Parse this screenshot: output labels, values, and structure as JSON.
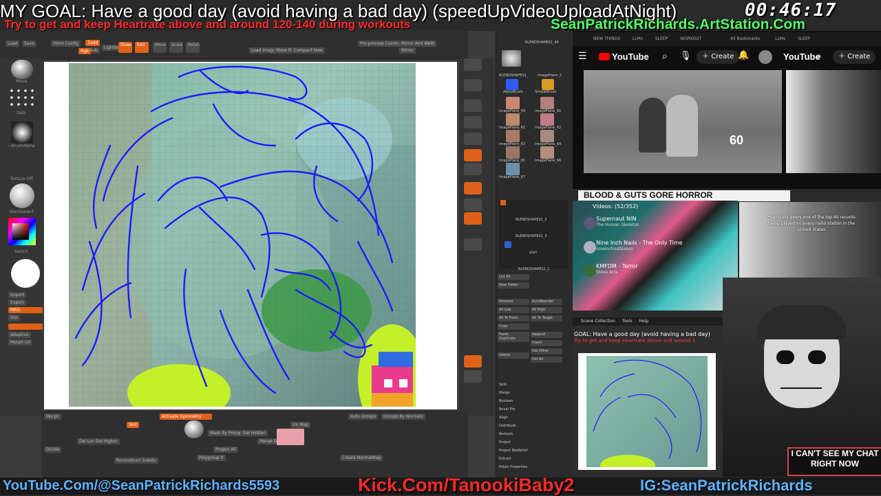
{
  "overlay": {
    "goal": "MY GOAL:   Have a good day (avoid having a bad day) (speedUpVideoUploadAtNight)",
    "clock": "00:46:17",
    "heartrate": "Try to get and keep Heartrate above and around 120-140 during workouts",
    "artstation": "SeanPatrickRichards.ArtStation.Com",
    "cant_see_chat": "I CAN'T SEE MY CHAT RIGHT NOW",
    "youtube": "YouTube.Com/@SeanPatrickRichards5593",
    "kick": "Kick.Com/TanookiBaby2",
    "instagram": "IG:SeanPatrickRichards"
  },
  "zbrush": {
    "top_buttons": [
      "Load",
      "Save",
      "Zadd",
      "Store Config",
      "Zsub",
      "Rgb",
      "Lightbox",
      "Draw",
      "Edit",
      "Move",
      "Scale",
      "Rotate",
      "Load Image",
      "Store Fill",
      "Compact Now",
      "Pre-process Current",
      "Mirror And Weld",
      "Mirror"
    ],
    "shelf_labels": [
      "Move",
      "Dots",
      "~BrushAlpha",
      "Texture Off",
      "SkinShade4",
      "Switch",
      "Import",
      "Export",
      "MRG",
      "Grp",
      "Adaptive",
      "Morph UV"
    ],
    "bottom_buttons": [
      "Morph",
      "Smt",
      "Activate Symmetry",
      "Auto Groups",
      "Groups By Normals",
      "Del Lower",
      "Del Higher",
      "Mask By Polygroups",
      "Merge Down",
      "Project All",
      "Divide",
      "Reconstruct Subdiv",
      "Create NormalMap",
      "Del Hidden",
      "UV Map",
      "Polygroup It"
    ],
    "subtool_items": [
      "BLENDSHAPES1_2",
      "BLENDSHAPES1_3",
      "shirt",
      "BLENDSHAPES1_1"
    ],
    "subtool_buttons": [
      "List All",
      "New Folder",
      "Rename",
      "AutoReorder",
      "All Low",
      "All High",
      "All To Front",
      "All To Target",
      "Copy",
      "Paste",
      "Duplicate",
      "Append",
      "Insert",
      "Delete",
      "Del Other",
      "Del All",
      "Split",
      "Merge",
      "Boolean",
      "Bevel Pro",
      "Align",
      "Distribute",
      "Remesh",
      "Project",
      "Project BasRelief",
      "Extract",
      "Polish Properties"
    ],
    "tray_labels": [
      "BLENDSHAPES1_49",
      "BLENDSHAPES1_",
      "ImagePlane_2",
      "AlphaBrush",
      "SimpleBrush",
      "ImagePlane_59",
      "ImagePlane_60",
      "ImagePlane_61",
      "ImagePlane_62",
      "ImagePlane_63",
      "ImagePlane_64",
      "ImagePlane_65",
      "ImagePlane_66",
      "ImagePlane_67"
    ]
  },
  "browser": {
    "bookmarks": [
      "NEW THINGS",
      "LLMs",
      "SLEEP",
      "WORKOUT",
      "All Bookmarks",
      "LLMs",
      "SLEEP"
    ],
    "yt_logo": "YouTube",
    "create": "Create",
    "video_counter": "60",
    "playlist_title": "BLOOD & GUTS GORE HORROR",
    "playlist_count": "Videos: (52/352)",
    "playlist_items": [
      {
        "title": "Supernaut NIN",
        "sub": "The Human Skeleton"
      },
      {
        "title": "Nine Inch Nails - The Only Time",
        "sub": "nineinchnailsvevo"
      },
      {
        "title": "KMFDM - Terror",
        "sub": "Steve Arra"
      }
    ],
    "caption": "Practically every one of the top 40 records being played on every radio station in the United States"
  },
  "mini": {
    "menu": [
      "Scene Collection",
      "Tools",
      "Help"
    ],
    "goal": "GOAL:  Have a good day (avoid having a bad day)",
    "hr": "Try to get and keep Heartrate above and around 1"
  }
}
